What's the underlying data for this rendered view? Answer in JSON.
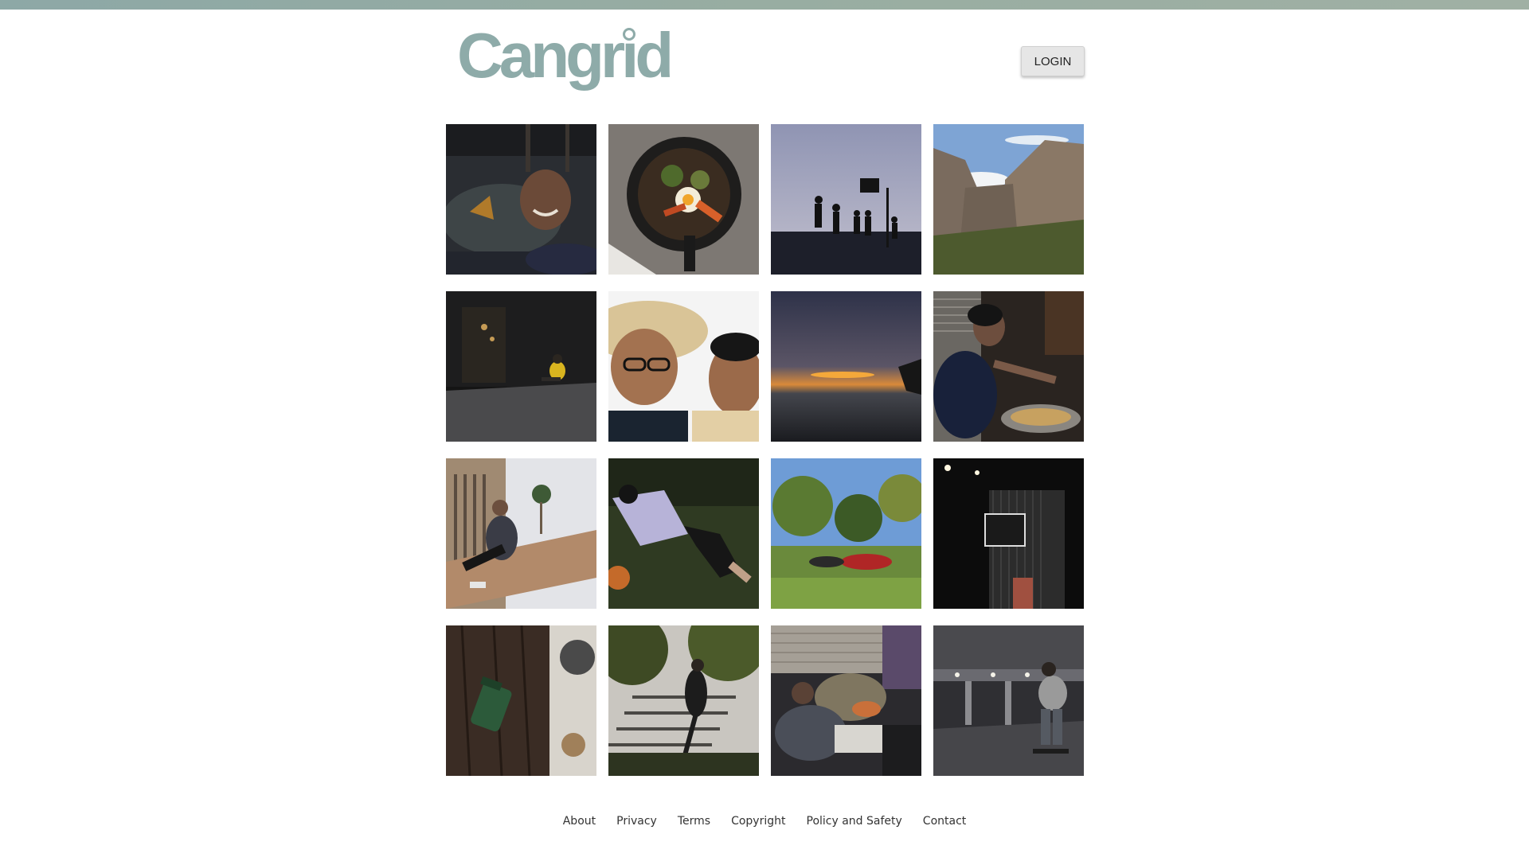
{
  "brand": {
    "logo_text": "Cangrid",
    "accent_color": "#8eaba9"
  },
  "header": {
    "login_label": "LOGIN"
  },
  "gallery": {
    "photos": [
      {
        "subject": "smiling man lying on floor"
      },
      {
        "subject": "bibimbap in cast iron pan"
      },
      {
        "subject": "basketball players silhouetted at dusk"
      },
      {
        "subject": "canyon cliffs under blue sky"
      },
      {
        "subject": "person in yellow sitting outside dark storefront"
      },
      {
        "subject": "two friends selfie, one in straw hat"
      },
      {
        "subject": "sunset over water"
      },
      {
        "subject": "man cooking in kitchen"
      },
      {
        "subject": "man sitting on bench by building with palm trees"
      },
      {
        "subject": "man lying on grass"
      },
      {
        "subject": "person lying in park under trees"
      },
      {
        "subject": "adidas storefront sign at night"
      },
      {
        "subject": "green lantern hanging on tree trunk"
      },
      {
        "subject": "person standing under trees near stairs"
      },
      {
        "subject": "person asleep on couch"
      },
      {
        "subject": "skateboarder in parking garage"
      }
    ]
  },
  "footer": {
    "links": [
      "About",
      "Privacy",
      "Terms",
      "Copyright",
      "Policy and Safety",
      "Contact"
    ]
  }
}
